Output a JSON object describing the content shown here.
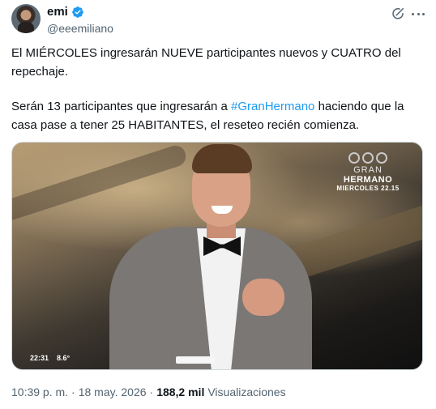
{
  "author": {
    "display_name": "emi",
    "handle": "@eeemiliano",
    "verified": true,
    "avatar_icon": "person-avatar"
  },
  "actions": {
    "grok_icon": "grok-icon",
    "more_icon": "more-options-icon"
  },
  "tweet": {
    "paragraph1": "El MIÉRCOLES ingresarán NUEVE participantes nuevos y CUATRO del repechaje.",
    "paragraph2_before": "Serán 13 participantes que ingresarán a ",
    "hashtag": "#GranHermano",
    "paragraph2_after": " haciendo que la casa pase a tener 25 HABITANTES, el reseteo recién comienza."
  },
  "media": {
    "logo_line1": "GRAN",
    "logo_line2": "HERMANO",
    "logo_line3": "MIERCOLES 22.15",
    "clock": "22:31",
    "temperature": "8.6°"
  },
  "meta": {
    "time": "10:39 p. m.",
    "separator1": "·",
    "date": "18 may. 2026",
    "separator2": "·",
    "views_count": "188,2 mil",
    "views_label": "Visualizaciones"
  },
  "colors": {
    "link": "#1d9bf0",
    "secondary_text": "#536471",
    "primary_text": "#0f1419"
  }
}
